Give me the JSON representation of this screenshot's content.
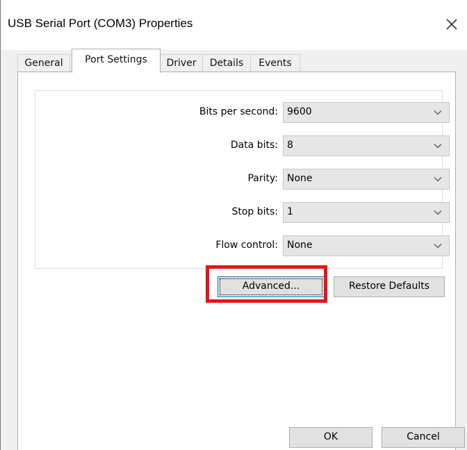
{
  "window": {
    "title": "USB Serial Port (COM3) Properties",
    "close_icon": "close-icon"
  },
  "tabs": [
    {
      "label": "General",
      "active": false
    },
    {
      "label": "Port Settings",
      "active": true
    },
    {
      "label": "Driver",
      "active": false
    },
    {
      "label": "Details",
      "active": false
    },
    {
      "label": "Events",
      "active": false
    }
  ],
  "settings": {
    "bits_per_second": {
      "label": "Bits per second:",
      "value": "9600"
    },
    "data_bits": {
      "label": "Data bits:",
      "value": "8"
    },
    "parity": {
      "label": "Parity:",
      "value": "None"
    },
    "stop_bits": {
      "label": "Stop bits:",
      "value": "1"
    },
    "flow_control": {
      "label": "Flow control:",
      "value": "None"
    }
  },
  "buttons": {
    "advanced": "Advanced...",
    "restore_defaults": "Restore Defaults",
    "ok": "OK",
    "cancel": "Cancel"
  },
  "colors": {
    "highlight": "#e8141c",
    "focus": "#0078d7"
  }
}
